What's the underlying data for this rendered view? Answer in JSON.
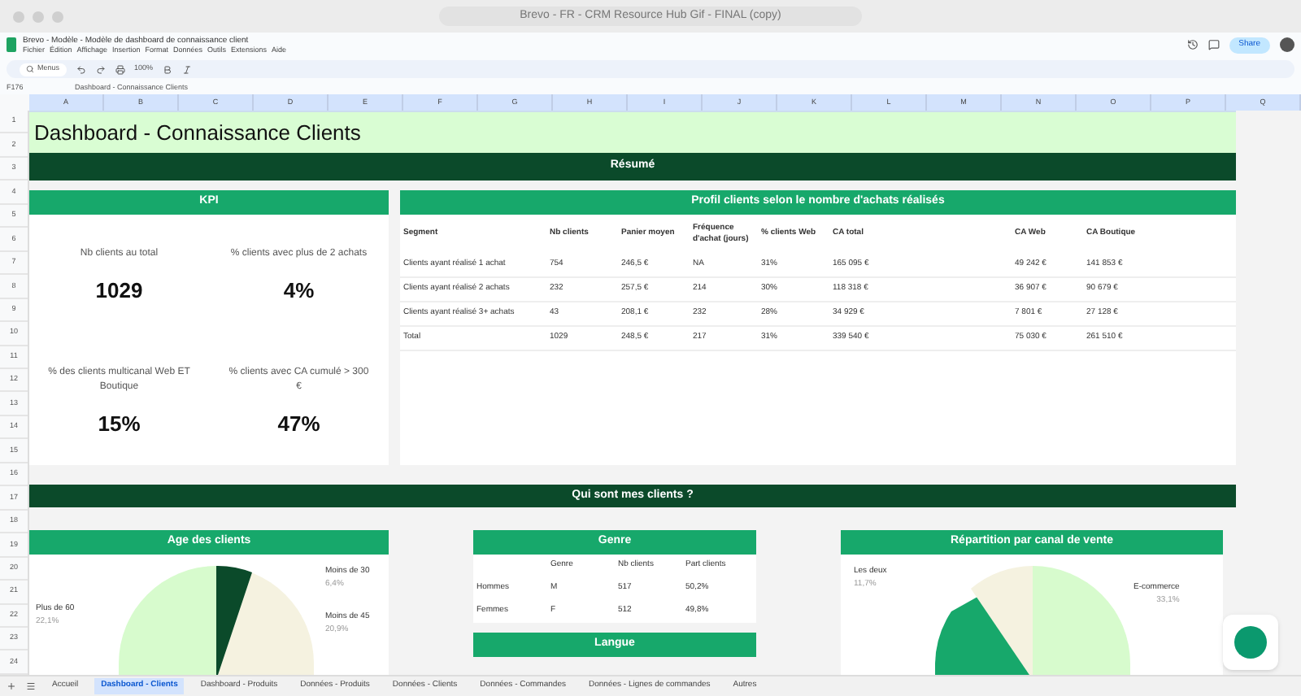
{
  "window": {
    "title": "Brevo - FR - CRM Resource Hub Gif - FINAL (copy)"
  },
  "doc": {
    "title": "Brevo - Modèle - Modèle de dashboard de connaissance client",
    "menu": [
      "Fichier",
      "Édition",
      "Affichage",
      "Insertion",
      "Format",
      "Données",
      "Outils",
      "Extensions",
      "Aide"
    ],
    "search": "Menus",
    "zoom": "100%",
    "share": "Share"
  },
  "formula_bar": {
    "cell": "F176",
    "value": "Dashboard - Connaissance Clients"
  },
  "columns": [
    "A",
    "B",
    "C",
    "D",
    "E",
    "F",
    "G",
    "H",
    "I",
    "J",
    "K",
    "L",
    "M",
    "N",
    "O",
    "P",
    "Q"
  ],
  "rows": [
    "1",
    "2",
    "3",
    "4",
    "5",
    "6",
    "7",
    "8",
    "9",
    "10",
    "11",
    "12",
    "13",
    "14",
    "15",
    "16",
    "17",
    "18",
    "19",
    "20",
    "21",
    "22",
    "23",
    "24"
  ],
  "dashboard": {
    "title": "Dashboard - Connaissance Clients",
    "summary_band": "Résumé",
    "section_band": "Qui sont mes clients ?",
    "kpi": {
      "title": "KPI",
      "items": [
        {
          "label": "Nb clients au total",
          "value": "1029"
        },
        {
          "label": "% clients avec plus de 2 achats",
          "value": "4%"
        },
        {
          "label": "% des clients multicanal Web ET Boutique",
          "value": "15%"
        },
        {
          "label": "% clients avec CA cumulé > 300 €",
          "value": "47%"
        }
      ]
    },
    "profile": {
      "title": "Profil clients selon le nombre d'achats réalisés",
      "columns": [
        "Segment",
        "Nb clients",
        "Panier moyen",
        "Fréquence d'achat (jours)",
        "% clients Web",
        "CA total",
        "CA Web",
        "CA Boutique"
      ],
      "rows": [
        [
          "Clients ayant réalisé 1 achat",
          "754",
          "246,5 €",
          "NA",
          "31%",
          "165 095 €",
          "49 242 €",
          "141 853 €"
        ],
        [
          "Clients ayant réalisé 2 achats",
          "232",
          "257,5 €",
          "214",
          "30%",
          "118 318 €",
          "36 907 €",
          "90 679 €"
        ],
        [
          "Clients ayant réalisé 3+ achats",
          "43",
          "208,1 €",
          "232",
          "28%",
          "34 929 €",
          "7 801 €",
          "27 128 €"
        ],
        [
          "Total",
          "1029",
          "248,5 €",
          "217",
          "31%",
          "339 540 €",
          "75 030 €",
          "261 510 €"
        ]
      ]
    },
    "age": {
      "title": "Age des clients",
      "labels": [
        {
          "name": "Moins de 30",
          "value": "6,4%"
        },
        {
          "name": "Plus de 60",
          "value": "22,1%"
        },
        {
          "name": "Moins de 45",
          "value": "20,9%"
        }
      ]
    },
    "genre": {
      "title": "Genre",
      "columns": [
        "",
        "Genre",
        "Nb clients",
        "Part clients"
      ],
      "rows": [
        [
          "Hommes",
          "M",
          "517",
          "50,2%"
        ],
        [
          "Femmes",
          "F",
          "512",
          "49,8%"
        ]
      ]
    },
    "langue": {
      "title": "Langue"
    },
    "canal": {
      "title": "Répartition par canal de vente",
      "labels": [
        {
          "name": "Les deux",
          "value": "11,7%"
        },
        {
          "name": "E-commerce",
          "value": "33,1%"
        }
      ]
    }
  },
  "sheet_tabs": [
    {
      "label": "Accueil",
      "selected": false
    },
    {
      "label": "Dashboard - Clients",
      "selected": true
    },
    {
      "label": "Dashboard - Produits",
      "selected": false
    },
    {
      "label": "Données - Produits",
      "selected": false
    },
    {
      "label": "Données - Clients",
      "selected": false
    },
    {
      "label": "Données - Commandes",
      "selected": false
    },
    {
      "label": "Données - Lignes de commandes",
      "selected": false
    },
    {
      "label": "Autres",
      "selected": false
    }
  ]
}
